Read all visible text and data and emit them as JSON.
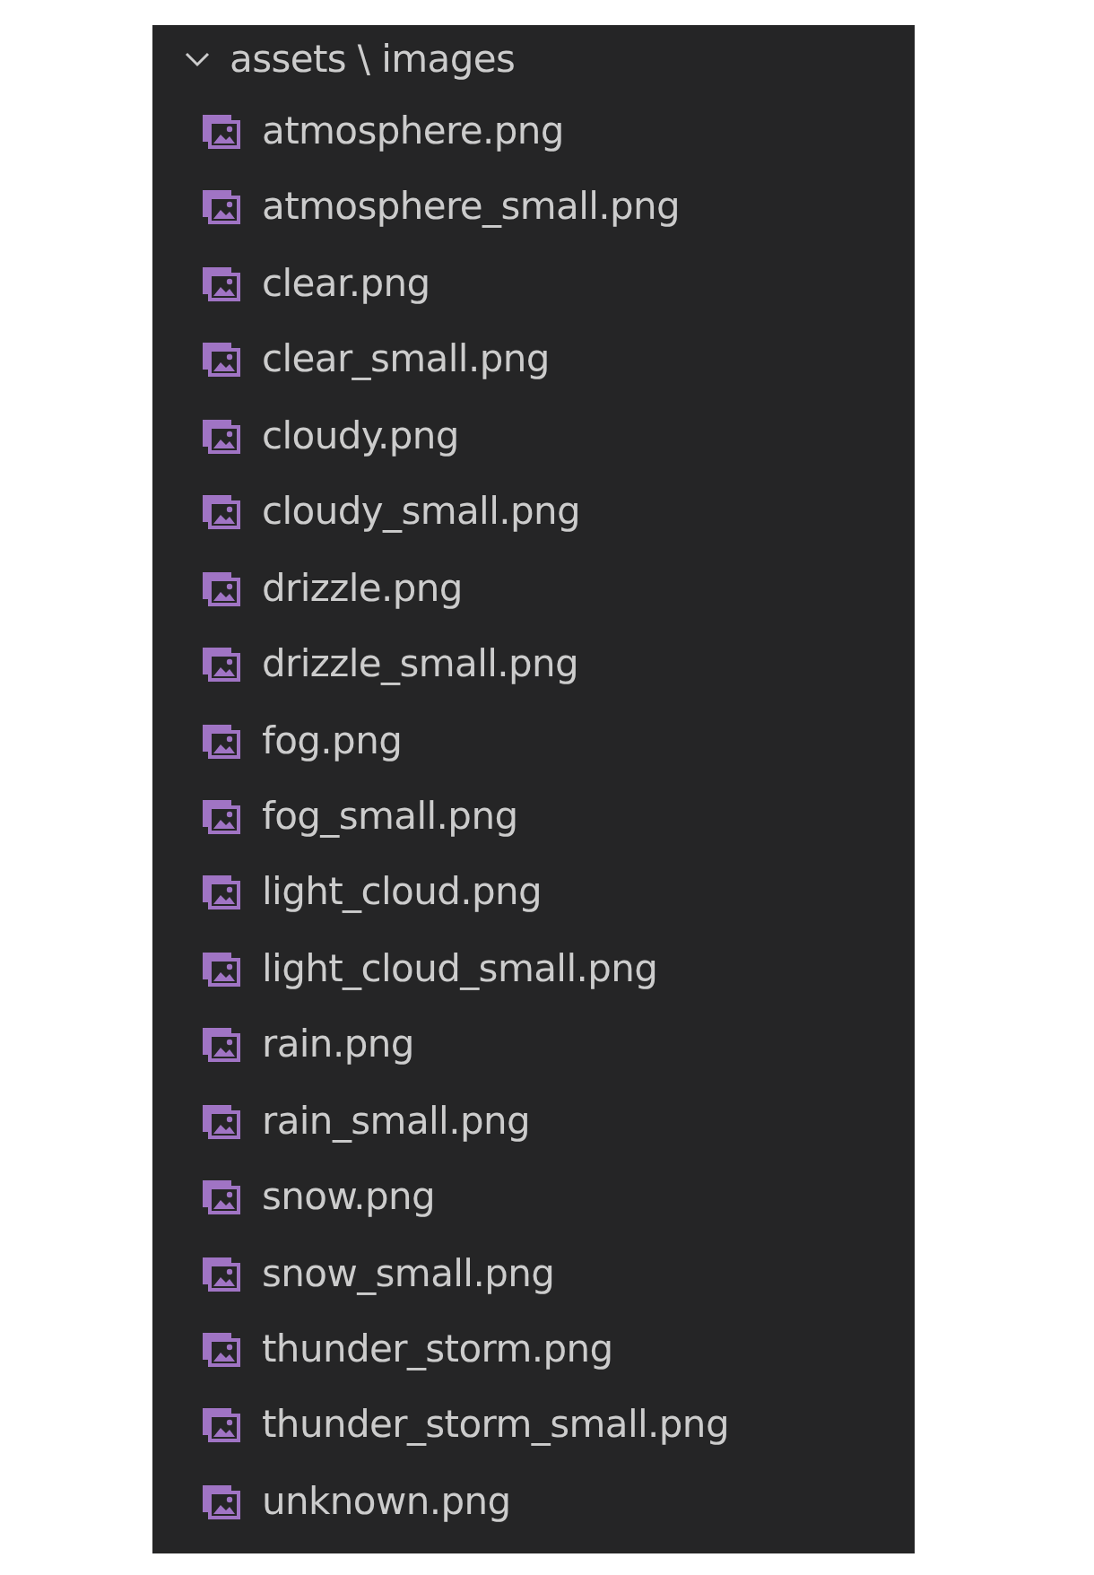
{
  "folder": {
    "label": "assets \\ images",
    "expanded": true,
    "children": [
      {
        "name": "atmosphere.png"
      },
      {
        "name": "atmosphere_small.png"
      },
      {
        "name": "clear.png"
      },
      {
        "name": "clear_small.png"
      },
      {
        "name": "cloudy.png"
      },
      {
        "name": "cloudy_small.png"
      },
      {
        "name": "drizzle.png"
      },
      {
        "name": "drizzle_small.png"
      },
      {
        "name": "fog.png"
      },
      {
        "name": "fog_small.png"
      },
      {
        "name": "light_cloud.png"
      },
      {
        "name": "light_cloud_small.png"
      },
      {
        "name": "rain.png"
      },
      {
        "name": "rain_small.png"
      },
      {
        "name": "snow.png"
      },
      {
        "name": "snow_small.png"
      },
      {
        "name": "thunder_storm.png"
      },
      {
        "name": "thunder_storm_small.png"
      },
      {
        "name": "unknown.png"
      }
    ]
  }
}
